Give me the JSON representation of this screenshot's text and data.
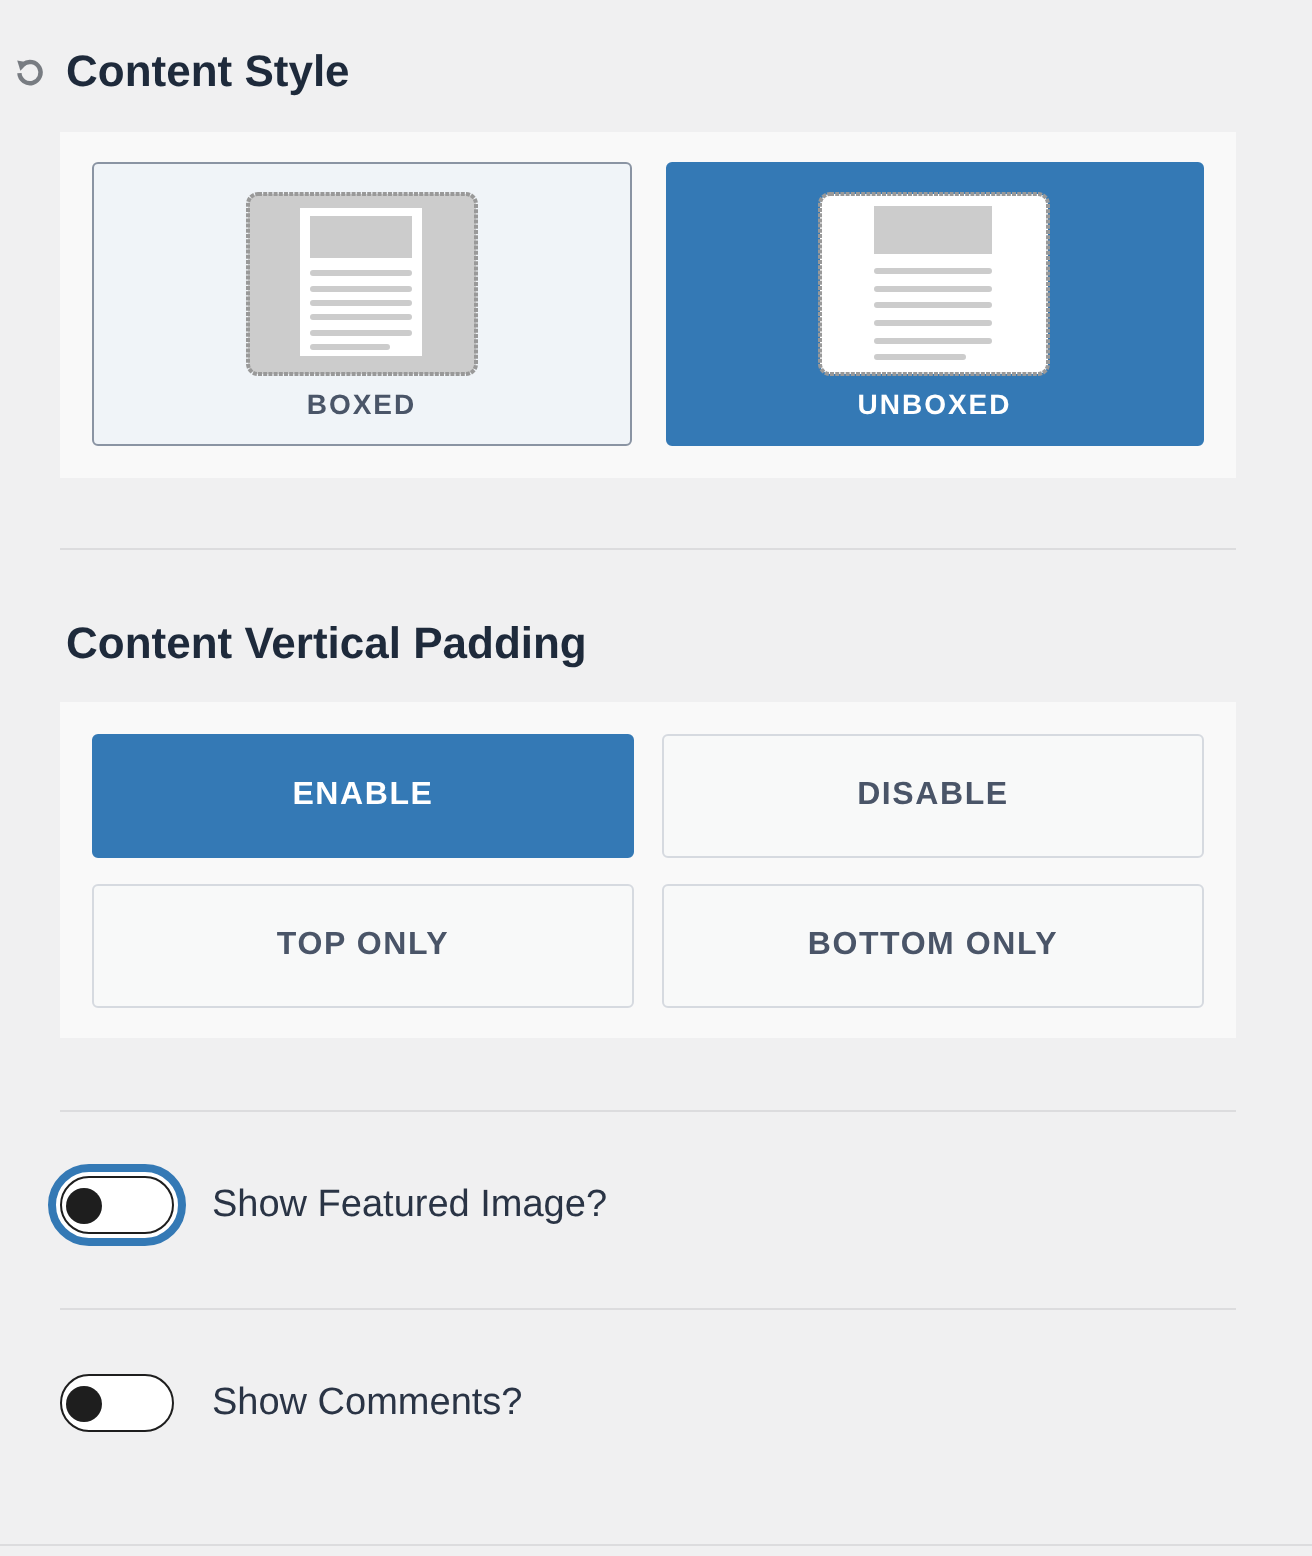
{
  "content_style": {
    "title": "Content Style",
    "options": [
      {
        "label": "BOXED",
        "kind": "boxed",
        "selected": false
      },
      {
        "label": "UNBOXED",
        "kind": "unboxed",
        "selected": true
      }
    ]
  },
  "vertical_padding": {
    "title": "Content Vertical Padding",
    "options": [
      {
        "label": "ENABLE",
        "selected": true
      },
      {
        "label": "DISABLE",
        "selected": false
      },
      {
        "label": "TOP ONLY",
        "selected": false
      },
      {
        "label": "BOTTOM ONLY",
        "selected": false
      }
    ]
  },
  "toggles": [
    {
      "label": "Show Featured Image?",
      "on": false,
      "focused": true
    },
    {
      "label": "Show Comments?",
      "on": false,
      "focused": false
    }
  ]
}
